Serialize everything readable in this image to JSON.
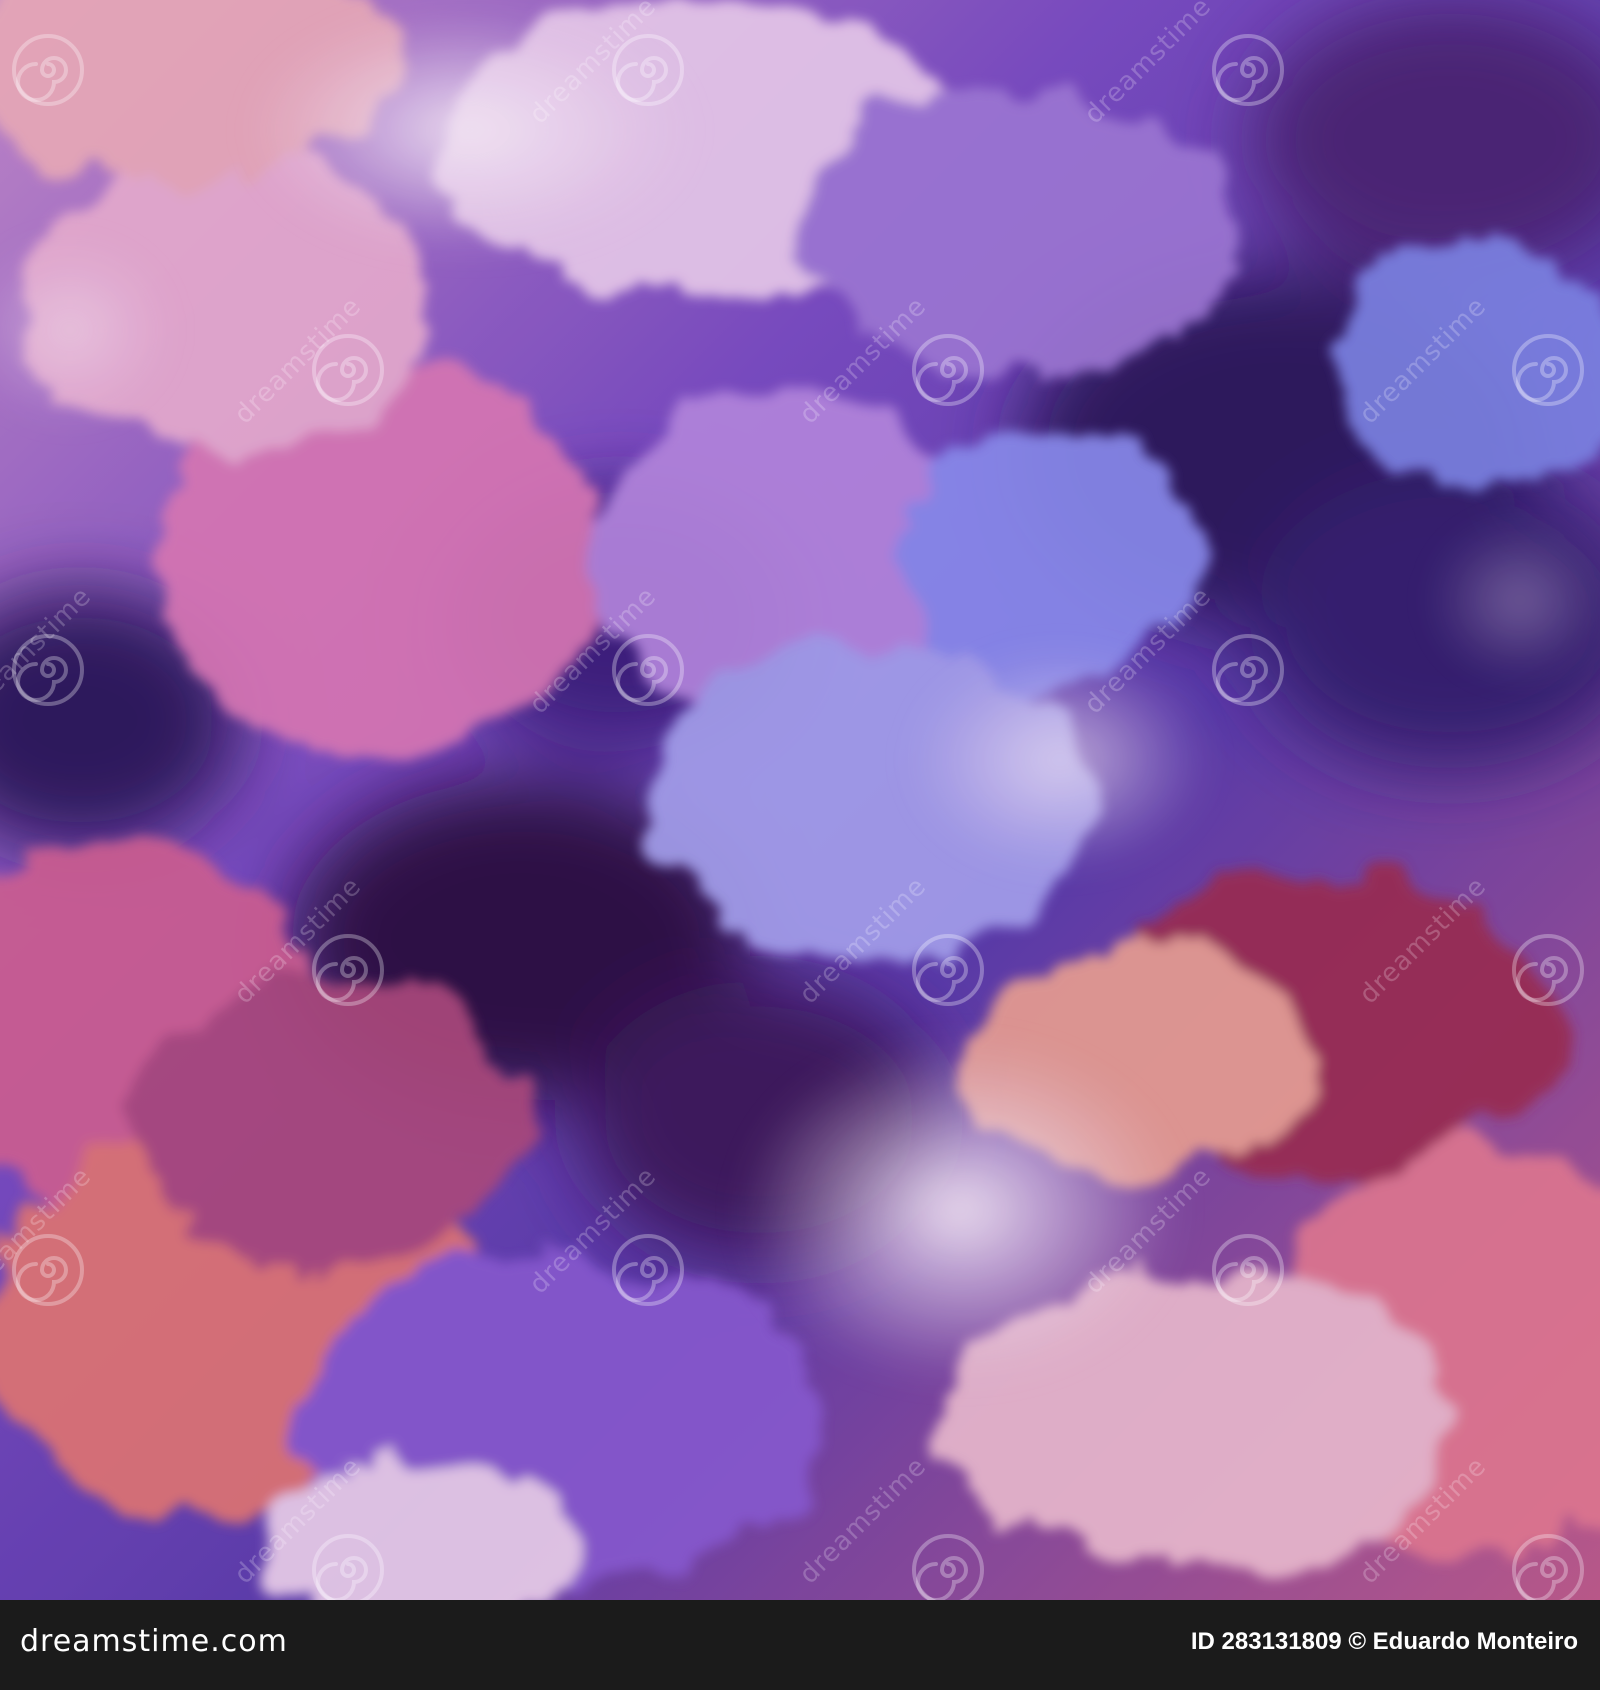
{
  "image": {
    "subject": "clouds",
    "palette": {
      "violet": "#5a3aa8",
      "deep_indigo": "#2a1257",
      "lavender": "#b89be6",
      "pink": "#e07ab4",
      "coral": "#e8776e",
      "crimson": "#9e2a4c",
      "periwinkle": "#8c8ff0",
      "glow": "#f6e2f2"
    }
  },
  "watermark": {
    "text": "dreamstime",
    "icon": "spiral-icon"
  },
  "footer": {
    "brand": "dreamstime.com",
    "credit": "ID 283131809 © Eduardo Monteiro"
  }
}
